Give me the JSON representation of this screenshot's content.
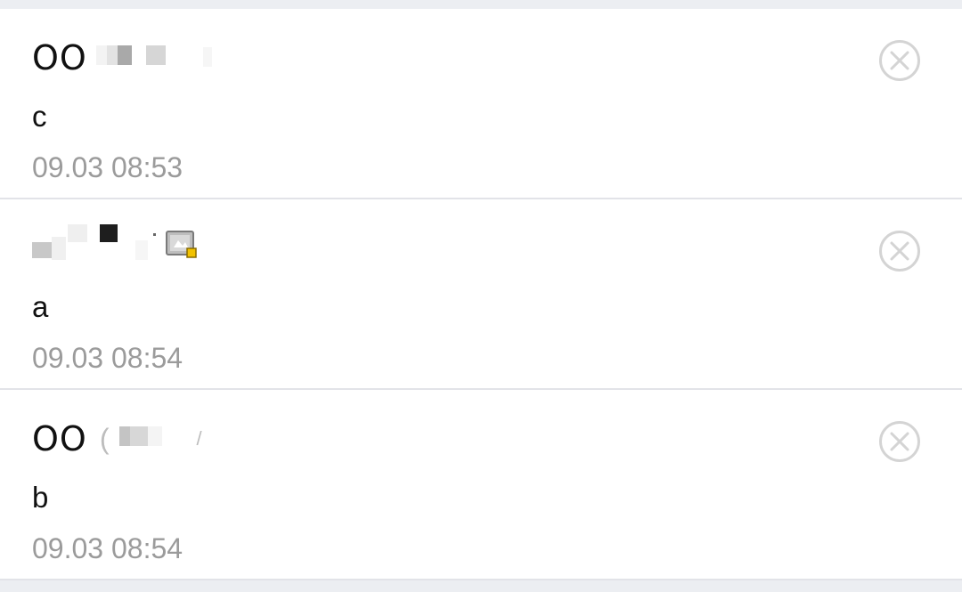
{
  "notifications": [
    {
      "sender_prefix": "OO",
      "message": "c",
      "time": "09.03 08:53"
    },
    {
      "sender_prefix": "",
      "message": "a",
      "time": "09.03 08:54"
    },
    {
      "sender_prefix": "OO",
      "sender_paren_open": "(",
      "sender_paren_close": "/",
      "message": "b",
      "time": "09.03 08:54"
    }
  ],
  "icons": {
    "delete": "close-circle-icon",
    "badge": "certified-badge-icon"
  },
  "colors": {
    "background": "#eceef2",
    "card": "#ffffff",
    "divider": "#e2e3e8",
    "text_primary": "#111111",
    "text_secondary": "#9b9b9b",
    "delete_icon": "#d4d4d4",
    "badge_accent": "#f2c200"
  }
}
